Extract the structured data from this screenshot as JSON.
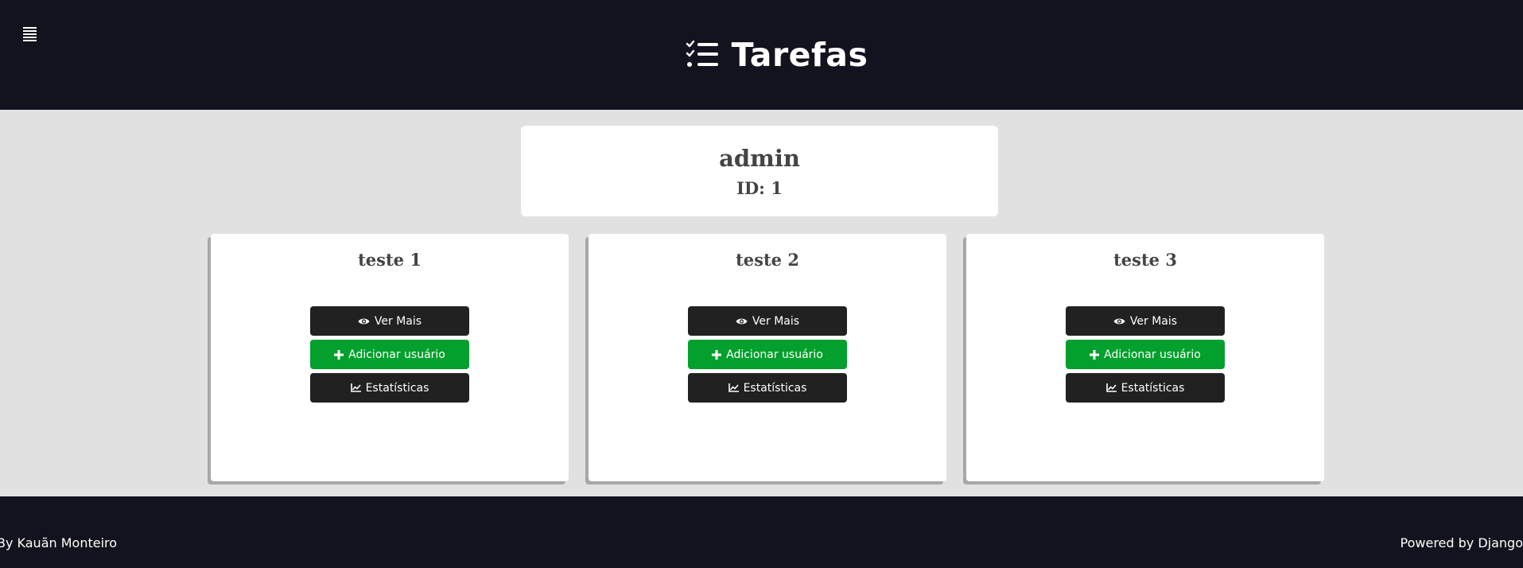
{
  "header": {
    "title": "Tarefas",
    "menu_icon": "menu-lines-icon",
    "brand_icon": "task-list-check-icon",
    "background": "#13131f"
  },
  "user": {
    "name": "admin",
    "id_text": "ID: 1"
  },
  "tasks": [
    {
      "title": "teste 1",
      "buttons": {
        "view": "Ver Mais",
        "add_user": "Adicionar usuário",
        "stats": "Estatísticas"
      }
    },
    {
      "title": "teste 2",
      "buttons": {
        "view": "Ver Mais",
        "add_user": "Adicionar usuário",
        "stats": "Estatísticas"
      }
    },
    {
      "title": "teste 3",
      "buttons": {
        "view": "Ver Mais",
        "add_user": "Adicionar usuário",
        "stats": "Estatísticas"
      }
    }
  ],
  "icons": {
    "view": "eye-icon",
    "add_user": "plus-icon",
    "stats": "line-chart-icon"
  },
  "colors": {
    "dark_button": "#212121",
    "green_button": "#03a02d",
    "page_background": "#e1e1e1",
    "card_background": "#ffffff"
  },
  "footer": {
    "left_text": "By Kauãn Monteiro",
    "right_text": "Powered by Django"
  }
}
